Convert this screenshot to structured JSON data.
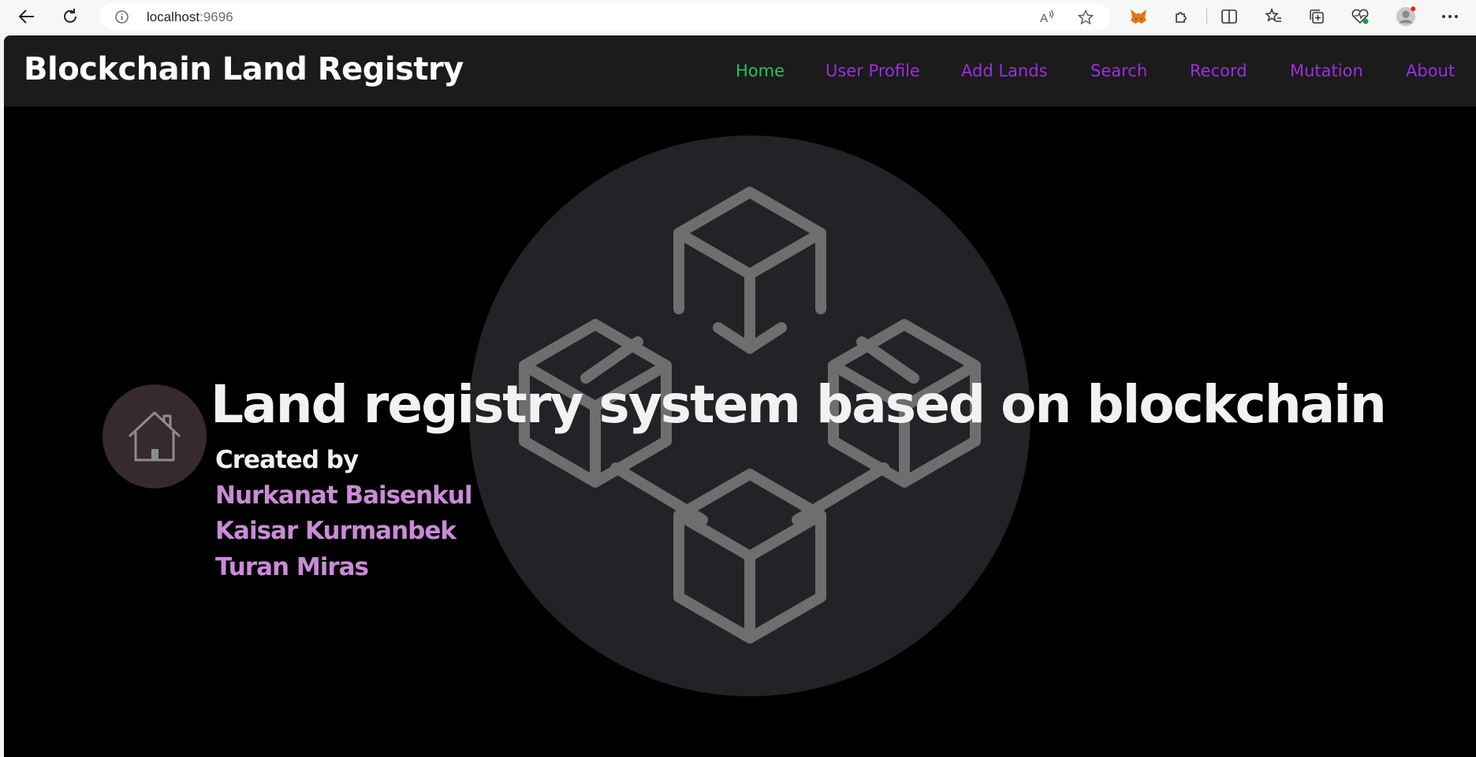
{
  "browser": {
    "url_host": "localhost",
    "url_port": ":9696",
    "icons": [
      "back-icon",
      "reload-icon",
      "site-info-icon",
      "read-aloud-icon",
      "favorite-star-icon",
      "metamask-fox-icon",
      "extensions-icon",
      "split-screen-icon",
      "favorites-icon",
      "collections-icon",
      "browser-essentials-icon",
      "profile-avatar-icon",
      "more-menu-icon"
    ]
  },
  "navbar": {
    "brand": "Blockchain Land Registry",
    "links": [
      {
        "label": "Home",
        "active": true
      },
      {
        "label": "User Profile",
        "active": false
      },
      {
        "label": "Add Lands",
        "active": false
      },
      {
        "label": "Search",
        "active": false
      },
      {
        "label": "Record",
        "active": false
      },
      {
        "label": "Mutation",
        "active": false
      },
      {
        "label": "About",
        "active": false
      }
    ]
  },
  "hero": {
    "title": "Land registry system based on blockchain",
    "created_by": "Created by",
    "authors": [
      "Nurkanat Baisenkul",
      "Kaisar Kurmanbek",
      "Turan Miras"
    ],
    "graphic": "blockchain-cubes-icon",
    "badge_icon": "house-icon"
  },
  "colors": {
    "nav_active": "#25c45a",
    "nav_link": "#9b30d9",
    "author": "#c98bd6",
    "navbar_bg": "#1b1b1c",
    "page_bg": "#000000"
  }
}
